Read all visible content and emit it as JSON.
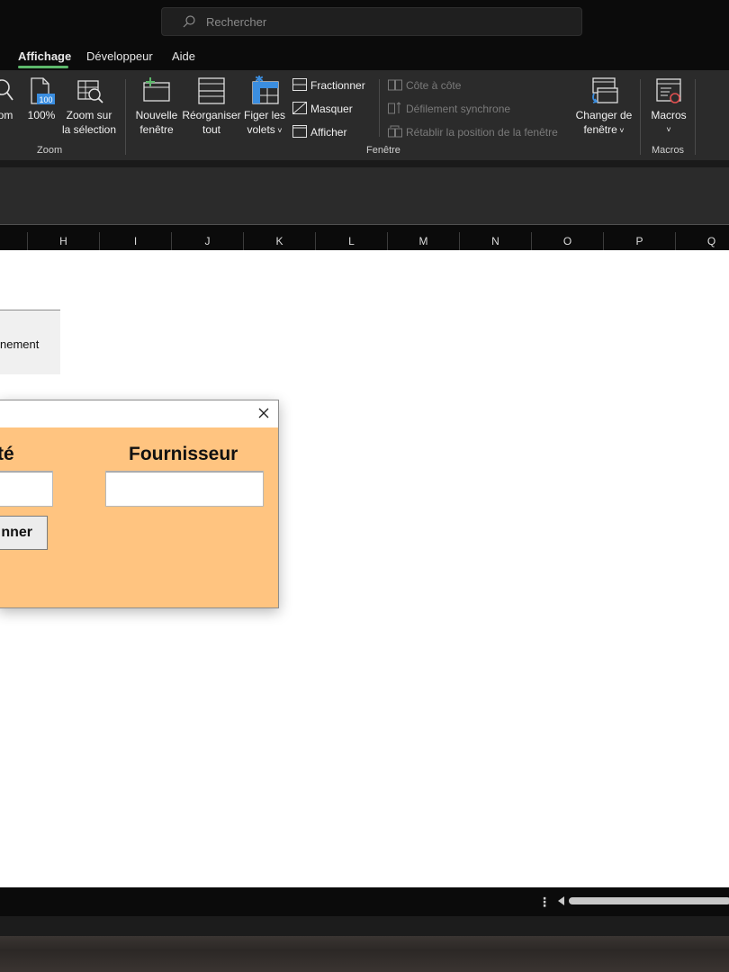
{
  "search": {
    "placeholder": "Rechercher"
  },
  "tabs": [
    "Affichage",
    "Développeur",
    "Aide"
  ],
  "ribbon": {
    "zoom_partial": "om",
    "zoom100": "100%",
    "zoom100_badge": "100",
    "zoom_sel_1": "Zoom sur",
    "zoom_sel_2": "la sélection",
    "new_window_1": "Nouvelle",
    "new_window_2": "fenêtre",
    "arrange_1": "Réorganiser",
    "arrange_2": "tout",
    "freeze_1": "Figer les",
    "freeze_2": "volets",
    "split": "Fractionner",
    "hide": "Masquer",
    "show": "Afficher",
    "side_by_side": "Côte à côte",
    "sync_scroll": "Défilement synchrone",
    "reset_pos": "Rétablir la position de la fenêtre",
    "switch_1": "Changer de",
    "switch_2": "fenêtre",
    "macros": "Macros",
    "groups": {
      "zoom": "Zoom",
      "window": "Fenêtre",
      "macros": "Macros"
    }
  },
  "columns": [
    "",
    "H",
    "I",
    "J",
    "K",
    "L",
    "M",
    "N",
    "O",
    "P",
    "Q"
  ],
  "sheet": {
    "button_text": "nement"
  },
  "dialog": {
    "label_left": "té",
    "label_right": "Fournisseur",
    "button": "nner"
  },
  "colors": {
    "accent": "#5db86b",
    "dialog_bg": "#ffc480",
    "ribbon_bg": "#2b2b2b"
  }
}
